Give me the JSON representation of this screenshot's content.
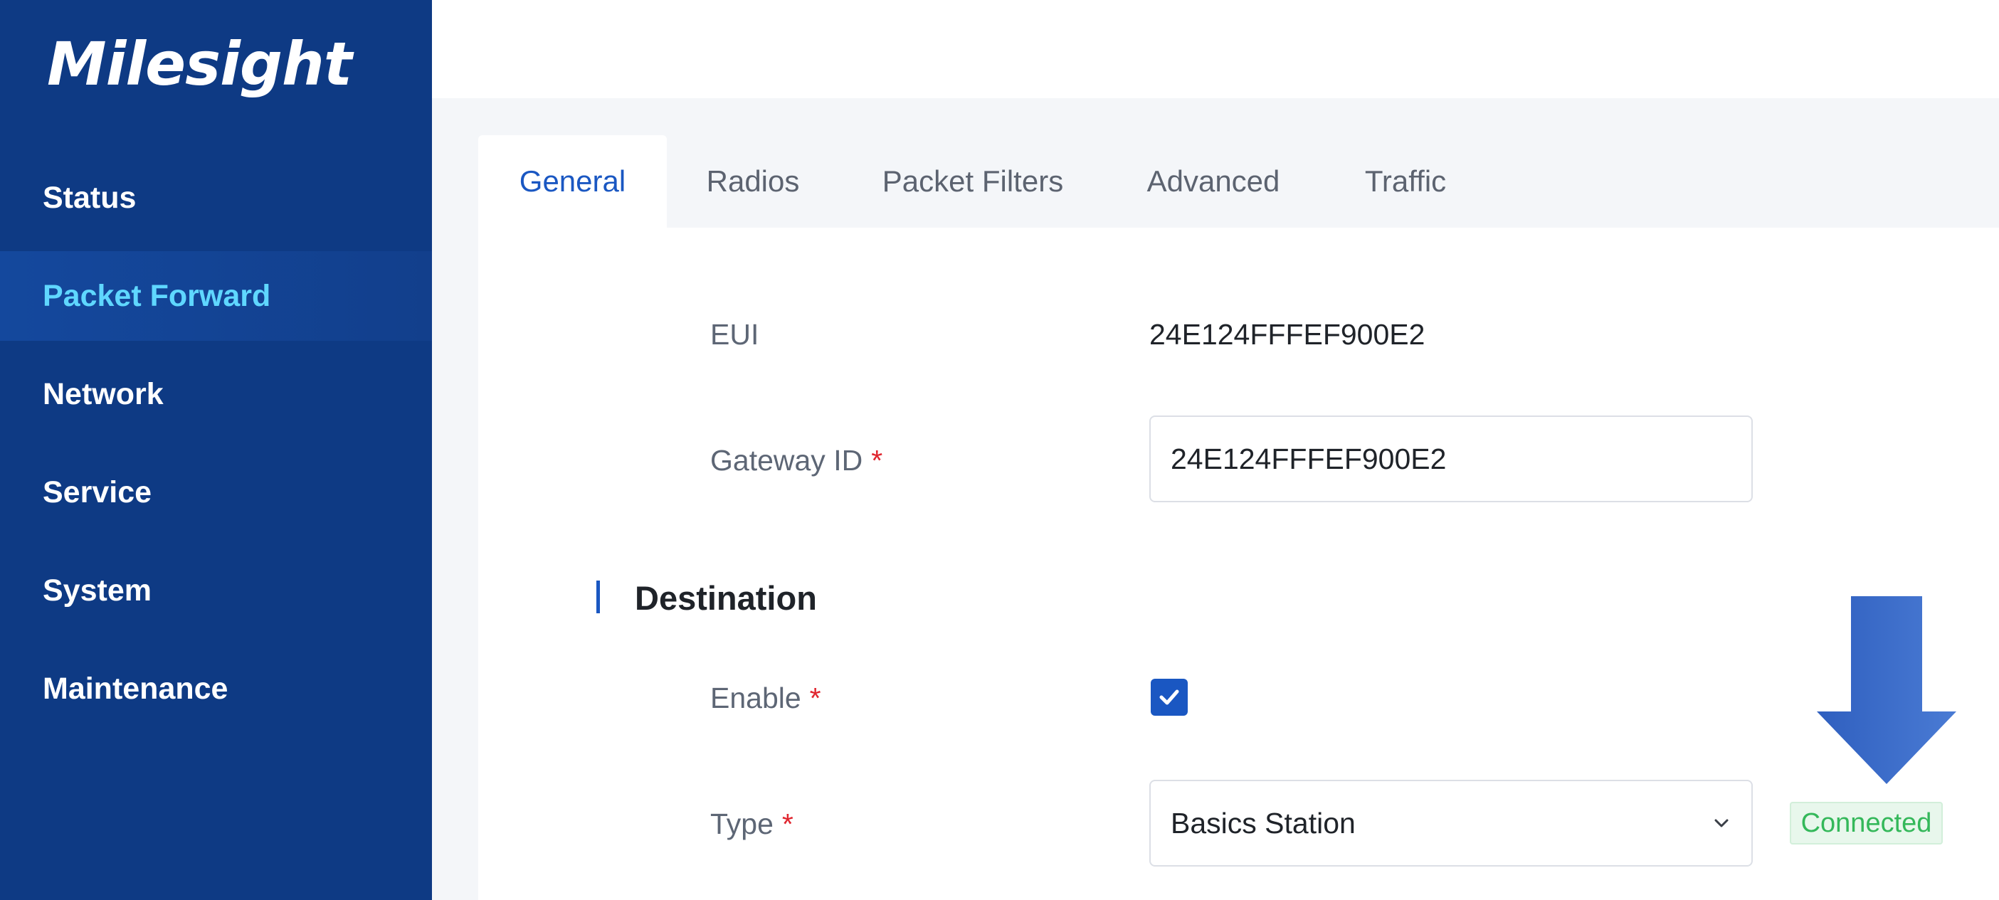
{
  "brand": {
    "logo_text": "Milesight"
  },
  "sidebar": {
    "items": [
      {
        "label": "Status",
        "active": false
      },
      {
        "label": "Packet Forward",
        "active": true
      },
      {
        "label": "Network",
        "active": false
      },
      {
        "label": "Service",
        "active": false
      },
      {
        "label": "System",
        "active": false
      },
      {
        "label": "Maintenance",
        "active": false
      }
    ]
  },
  "tabs": [
    {
      "label": "General",
      "active": true
    },
    {
      "label": "Radios",
      "active": false
    },
    {
      "label": "Packet Filters",
      "active": false
    },
    {
      "label": "Advanced",
      "active": false
    },
    {
      "label": "Traffic",
      "active": false
    }
  ],
  "form": {
    "eui": {
      "label": "EUI",
      "value": "24E124FFFEF900E2"
    },
    "gateway_id": {
      "label": "Gateway ID",
      "required_mark": "*",
      "value": "24E124FFFEF900E2"
    },
    "destination": {
      "title": "Destination"
    },
    "enable": {
      "label": "Enable",
      "required_mark": "*",
      "checked": true
    },
    "type": {
      "label": "Type",
      "required_mark": "*",
      "value": "Basics Station",
      "status": "Connected"
    }
  },
  "icons": {
    "checkbox": "check-icon",
    "dropdown": "chevron-down-icon",
    "annotation": "arrow-down-icon"
  },
  "colors": {
    "sidebar_bg": "#0e3a84",
    "active_nav_text": "#5fd7ff",
    "accent": "#1a57c2",
    "required": "#e0262f",
    "status_connected": "#34b85a",
    "annotation_arrow": "#3a6cc8"
  }
}
